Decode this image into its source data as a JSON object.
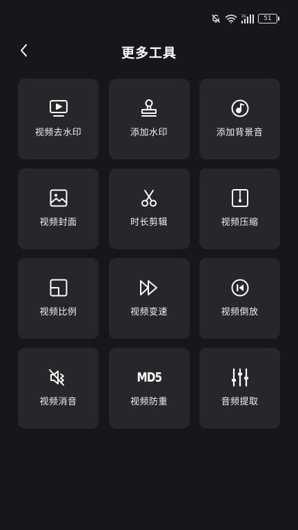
{
  "status_bar": {
    "battery_level": "51",
    "icons": [
      "mute-icon",
      "wifi-icon",
      "cellular-signal-icon",
      "battery-icon"
    ]
  },
  "header": {
    "title": "更多工具",
    "back_icon": "chevron-left-icon"
  },
  "tools": [
    {
      "label": "视频去水印",
      "icon": "tv-play-icon"
    },
    {
      "label": "添加水印",
      "icon": "stamp-icon"
    },
    {
      "label": "添加背景音",
      "icon": "music-disc-icon"
    },
    {
      "label": "视频封面",
      "icon": "image-icon"
    },
    {
      "label": "时长剪辑",
      "icon": "scissors-icon"
    },
    {
      "label": "视频压缩",
      "icon": "zip-file-icon"
    },
    {
      "label": "视频比例",
      "icon": "aspect-ratio-icon"
    },
    {
      "label": "视频变速",
      "icon": "fast-forward-icon"
    },
    {
      "label": "视频倒放",
      "icon": "rewind-icon"
    },
    {
      "label": "视频消音",
      "icon": "speaker-mute-icon"
    },
    {
      "label": "视频防重",
      "icon": "md5-icon",
      "icon_text": "MD5"
    },
    {
      "label": "音频提取",
      "icon": "equalizer-icon"
    }
  ],
  "colors": {
    "background": "#16171a",
    "tile": "#26272a",
    "text": "#ffffff"
  }
}
